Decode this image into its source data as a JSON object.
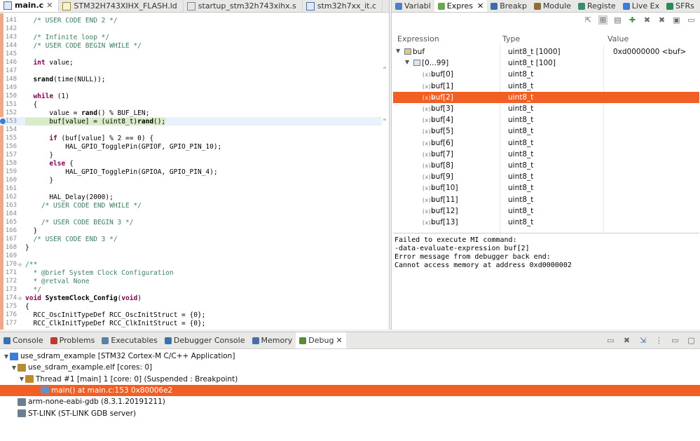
{
  "editor": {
    "tabs": [
      {
        "label": "main.c",
        "icon": "c-file-icon",
        "active": true,
        "close": "✕"
      },
      {
        "label": "STM32H743XIHX_FLASH.ld",
        "icon": "linker-file-icon",
        "active": false
      },
      {
        "label": "startup_stm32h743xihx.s",
        "icon": "asm-file-icon",
        "active": false
      },
      {
        "label": "stm32h7xx_it.c",
        "icon": "c-file-icon",
        "active": false
      }
    ],
    "lines": [
      {
        "n": "141",
        "t": "  /* USER CODE END 2 */"
      },
      {
        "n": "142",
        "t": ""
      },
      {
        "n": "143",
        "t": "  /* Infinite loop */"
      },
      {
        "n": "144",
        "t": "  /* USER CODE BEGIN WHILE */"
      },
      {
        "n": "145",
        "t": ""
      },
      {
        "n": "146",
        "t": "  int value;"
      },
      {
        "n": "147",
        "t": ""
      },
      {
        "n": "148",
        "t": "  srand(time(NULL));"
      },
      {
        "n": "149",
        "t": ""
      },
      {
        "n": "150",
        "t": "  while (1)"
      },
      {
        "n": "151",
        "t": "  {"
      },
      {
        "n": "152",
        "t": "      value = rand() % BUF_LEN;"
      },
      {
        "n": "153",
        "t": "      buf[value] = (uint8_t)rand();"
      },
      {
        "n": "154",
        "t": ""
      },
      {
        "n": "155",
        "t": "      if (buf[value] % 2 == 0) {"
      },
      {
        "n": "156",
        "t": "          HAL_GPIO_TogglePin(GPIOF, GPIO_PIN_10);"
      },
      {
        "n": "157",
        "t": "      }"
      },
      {
        "n": "158",
        "t": "      else {"
      },
      {
        "n": "159",
        "t": "          HAL_GPIO_TogglePin(GPIOA, GPIO_PIN_4);"
      },
      {
        "n": "160",
        "t": "      }"
      },
      {
        "n": "161",
        "t": ""
      },
      {
        "n": "162",
        "t": "      HAL_Delay(2000);"
      },
      {
        "n": "163",
        "t": "    /* USER CODE END WHILE */"
      },
      {
        "n": "164",
        "t": ""
      },
      {
        "n": "165",
        "t": "    /* USER CODE BEGIN 3 */"
      },
      {
        "n": "166",
        "t": "  }"
      },
      {
        "n": "167",
        "t": "  /* USER CODE END 3 */"
      },
      {
        "n": "168",
        "t": "}"
      },
      {
        "n": "169",
        "t": ""
      },
      {
        "n": "170",
        "t": "/**",
        "fold": "⊖"
      },
      {
        "n": "171",
        "t": "  * @brief System Clock Configuration"
      },
      {
        "n": "172",
        "t": "  * @retval None"
      },
      {
        "n": "173",
        "t": "  */"
      },
      {
        "n": "174",
        "t": "void SystemClock_Config(void)",
        "fold": "⊖"
      },
      {
        "n": "175",
        "t": "{"
      },
      {
        "n": "176",
        "t": "  RCC_OscInitTypeDef RCC_OscInitStruct = {0};"
      },
      {
        "n": "177",
        "t": "  RCC_ClkInitTypeDef RCC_ClkInitStruct = {0};"
      }
    ]
  },
  "views": {
    "tabs": [
      {
        "label": "Variabl",
        "icon": "variables-icon",
        "color": "#4a7fc1"
      },
      {
        "label": "Expres",
        "icon": "expressions-icon",
        "color": "#6aa84f",
        "active": true,
        "close": "✕"
      },
      {
        "label": "Breakp",
        "icon": "breakpoints-icon",
        "color": "#3b6ea5"
      },
      {
        "label": "Module",
        "icon": "modules-icon",
        "color": "#8e6c3a"
      },
      {
        "label": "Registe",
        "icon": "registers-icon",
        "color": "#3a8e6c"
      },
      {
        "label": "Live Ex",
        "icon": "live-expressions-icon",
        "color": "#3b7dd8"
      },
      {
        "label": "SFRs",
        "icon": "sfrs-icon",
        "color": "#2e8b57"
      }
    ]
  },
  "expressions": {
    "columns": [
      "Expression",
      "Type",
      "Value"
    ],
    "rows": [
      {
        "name": "buf",
        "type": "uint8_t [1000]",
        "value": "0xd0000000 <buf>",
        "level": 0,
        "twisty": "▼"
      },
      {
        "name": "[0...99]",
        "type": "uint8_t [100]",
        "value": "",
        "level": 1,
        "twisty": "▼"
      },
      {
        "name": "buf[0]",
        "type": "uint8_t",
        "value": "",
        "level": 2
      },
      {
        "name": "buf[1]",
        "type": "uint8_t",
        "value": "",
        "level": 2
      },
      {
        "name": "buf[2]",
        "type": "uint8_t",
        "value": "",
        "level": 2,
        "selected": true
      },
      {
        "name": "buf[3]",
        "type": "uint8_t",
        "value": "",
        "level": 2
      },
      {
        "name": "buf[4]",
        "type": "uint8_t",
        "value": "",
        "level": 2
      },
      {
        "name": "buf[5]",
        "type": "uint8_t",
        "value": "",
        "level": 2
      },
      {
        "name": "buf[6]",
        "type": "uint8_t",
        "value": "",
        "level": 2
      },
      {
        "name": "buf[7]",
        "type": "uint8_t",
        "value": "",
        "level": 2
      },
      {
        "name": "buf[8]",
        "type": "uint8_t",
        "value": "",
        "level": 2
      },
      {
        "name": "buf[9]",
        "type": "uint8_t",
        "value": "",
        "level": 2
      },
      {
        "name": "buf[10]",
        "type": "uint8_t",
        "value": "",
        "level": 2
      },
      {
        "name": "buf[11]",
        "type": "uint8_t",
        "value": "",
        "level": 2
      },
      {
        "name": "buf[12]",
        "type": "uint8_t",
        "value": "",
        "level": 2
      },
      {
        "name": "buf[13]",
        "type": "uint8_t",
        "value": "",
        "level": 2
      }
    ],
    "detail_lines": [
      "Failed to execute MI command:",
      "-data-evaluate-expression buf[2]",
      "Error message from debugger back end:",
      "Cannot access memory at address 0xd0000002"
    ],
    "variable_icon_label": "(x)="
  },
  "bottom": {
    "tabs": [
      {
        "label": "Console",
        "icon": "console-icon",
        "color": "#3a6fb0"
      },
      {
        "label": "Problems",
        "icon": "problems-icon",
        "color": "#c0392b"
      },
      {
        "label": "Executables",
        "icon": "executables-icon",
        "color": "#5b7fa8"
      },
      {
        "label": "Debugger Console",
        "icon": "debugger-console-icon",
        "color": "#3a6fb0"
      },
      {
        "label": "Memory",
        "icon": "memory-icon",
        "color": "#4a6fa5"
      },
      {
        "label": "Debug",
        "icon": "debug-icon",
        "color": "#5d8a3a",
        "active": true,
        "close": "✕"
      }
    ],
    "rows": [
      {
        "text": "use_sdram_example [STM32 Cortex-M C/C++ Application]",
        "level": 0,
        "twisty": "▼",
        "icon": "launch-config-icon",
        "color": "#3b7dd8"
      },
      {
        "text": "use_sdram_example.elf [cores: 0]",
        "level": 1,
        "twisty": "▼",
        "icon": "debug-target-icon",
        "color": "#b58a3a"
      },
      {
        "text": "Thread #1 [main] 1 [core: 0] (Suspended : Breakpoint)",
        "level": 2,
        "twisty": "▼",
        "icon": "thread-suspended-icon",
        "color": "#c08a2a"
      },
      {
        "text": "main() at main.c:153 0x80006e2",
        "level": 4,
        "twisty": "",
        "icon": "stack-frame-icon",
        "color": "#6a8fc5",
        "selected": true
      },
      {
        "text": "arm-none-eabi-gdb (8.3.1.20191211)",
        "level": 1,
        "twisty": "",
        "icon": "gdb-process-icon",
        "color": "#6b7f8f"
      },
      {
        "text": "ST-LINK (ST-LINK GDB server)",
        "level": 1,
        "twisty": "",
        "icon": "stlink-process-icon",
        "color": "#6b7f8f"
      }
    ]
  }
}
